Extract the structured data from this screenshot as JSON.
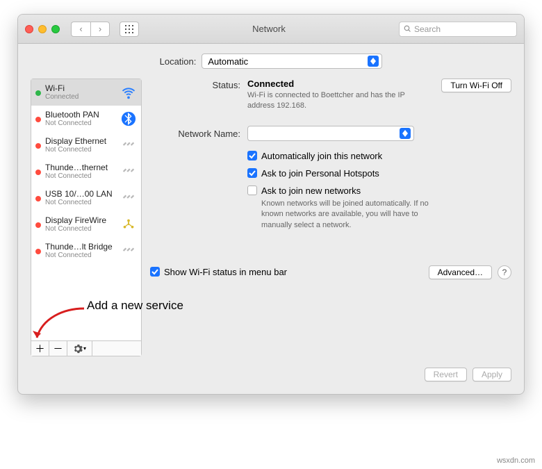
{
  "window": {
    "title": "Network"
  },
  "search": {
    "placeholder": "Search"
  },
  "location": {
    "label": "Location:",
    "value": "Automatic"
  },
  "sidebar": {
    "items": [
      {
        "name": "Wi-Fi",
        "status": "Connected",
        "color": "#2fb64a",
        "icon": "wifi",
        "selected": true
      },
      {
        "name": "Bluetooth PAN",
        "status": "Not Connected",
        "color": "#ff4b3e",
        "icon": "bluetooth"
      },
      {
        "name": "Display Ethernet",
        "status": "Not Connected",
        "color": "#ff4b3e",
        "icon": "chain"
      },
      {
        "name": "Thunde…thernet",
        "status": "Not Connected",
        "color": "#ff4b3e",
        "icon": "chain"
      },
      {
        "name": "USB 10/…00 LAN",
        "status": "Not Connected",
        "color": "#ff4b3e",
        "icon": "chain"
      },
      {
        "name": "Display FireWire",
        "status": "Not Connected",
        "color": "#ff4b3e",
        "icon": "firewire"
      },
      {
        "name": "Thunde…lt Bridge",
        "status": "Not Connected",
        "color": "#ff4b3e",
        "icon": "chain"
      }
    ]
  },
  "detail": {
    "status_label": "Status:",
    "status_value": "Connected",
    "turn_off": "Turn Wi-Fi Off",
    "status_sub": "Wi-Fi is connected to Boettcher and has the IP address 192.168.",
    "netname_label": "Network Name:",
    "netname_value": "",
    "auto_join": "Automatically join this network",
    "ask_hotspot": "Ask to join Personal Hotspots",
    "ask_new": "Ask to join new networks",
    "ask_new_help": "Known networks will be joined automatically. If no known networks are available, you will have to manually select a network.",
    "show_menubar": "Show Wi-Fi status in menu bar",
    "advanced": "Advanced…"
  },
  "buttons": {
    "revert": "Revert",
    "apply": "Apply"
  },
  "annotation": {
    "text": "Add a new service"
  },
  "watermark": "wsxdn.com"
}
